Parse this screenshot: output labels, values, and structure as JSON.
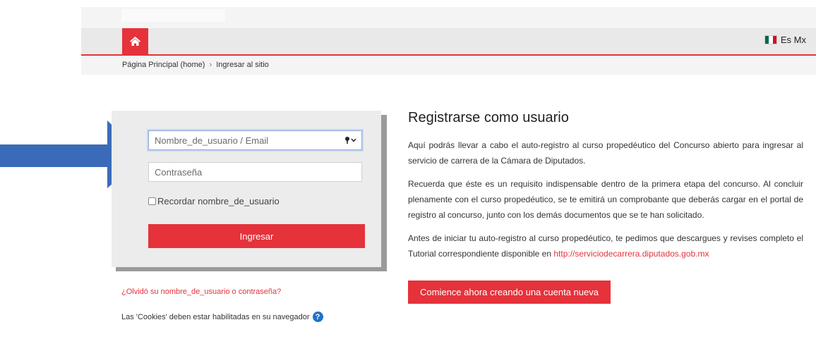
{
  "header": {
    "language_label": "Es Mx",
    "flag_colors": [
      "#006847",
      "#ffffff",
      "#ce1126"
    ],
    "accent_color": "#e5323b"
  },
  "breadcrumb": {
    "home": "Página Principal (home)",
    "separator": "›",
    "current": "Ingresar al sitio"
  },
  "login": {
    "username_placeholder": "Nombre_de_usuario / Email",
    "password_placeholder": "Contraseña",
    "remember_label": "Recordar nombre_de_usuario",
    "submit_label": "Ingresar",
    "forgot_link": "¿Olvidó su nombre_de_usuario o contraseña?",
    "cookies_notice": "Las 'Cookies' deben estar habilitadas en su navegador"
  },
  "register": {
    "title": "Registrarse como usuario",
    "paragraph1": "Aquí podrás llevar a cabo el auto-registro al curso propedéutico del Concurso abierto para ingresar al servicio de carrera de la Cámara de Diputados.",
    "paragraph2": "Recuerda que éste es un requisito indispensable dentro de la primera etapa del concurso. Al concluir plenamente con el curso propedéutico, se te emitirá un comprobante que deberás cargar en el portal de registro al concurso, junto con los demás documentos que se te han solicitado.",
    "paragraph3_text": "Antes de iniciar tu auto-registro al curso propedéutico, te pedimos que descargues y revises completo el Tutorial correspondiente disponible en ",
    "paragraph3_link": "http://serviciodecarrera.diputados.gob.mx",
    "create_button": "Comience ahora creando una cuenta nueva"
  },
  "annotation": {
    "arrow_color": "#3a6bb8"
  }
}
